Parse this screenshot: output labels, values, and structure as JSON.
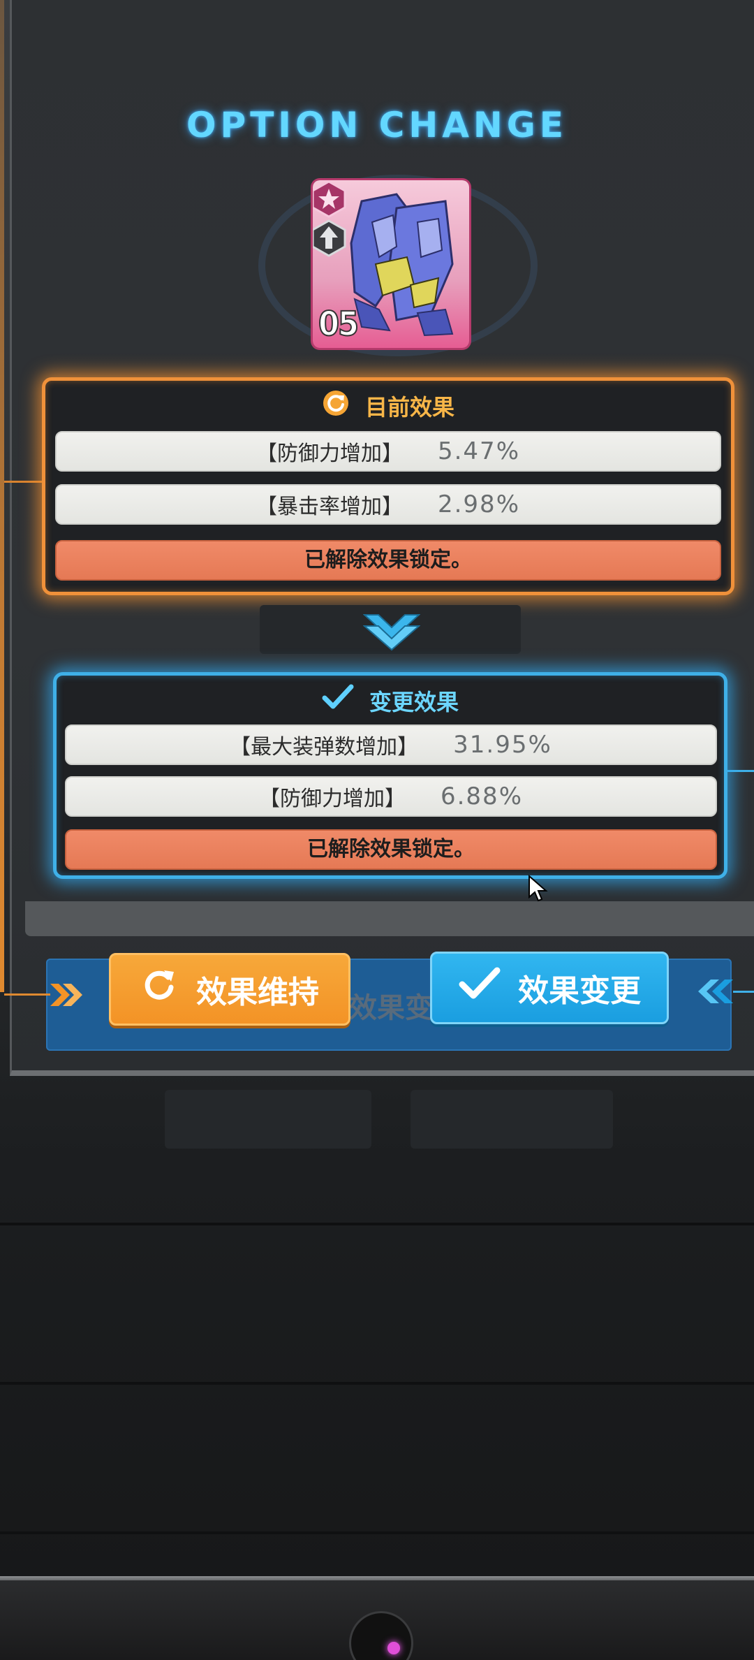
{
  "title": "OPTION CHANGE",
  "item_card": {
    "level": "05",
    "badge_top_icon": "star-emblem-icon",
    "badge_mid_icon": "arrow-emblem-icon",
    "art_icon": "mech-part-icon"
  },
  "current_effect": {
    "header": "目前效果",
    "header_icon": "refresh-icon",
    "rows": [
      {
        "name": "【防御力增加】",
        "value": "5.47%"
      },
      {
        "name": "【暴击率增加】",
        "value": "2.98%"
      }
    ],
    "lock_status": "已解除效果锁定。"
  },
  "changed_effect": {
    "header": "变更效果",
    "header_icon": "check-icon",
    "rows": [
      {
        "name": "【最大装弹数增加】",
        "value": "31.95%"
      },
      {
        "name": "【防御力增加】",
        "value": "6.88%"
      }
    ],
    "lock_status": "已解除效果锁定。"
  },
  "buttons": {
    "keep_label": "效果维持",
    "change_label": "效果变更",
    "background_text": "效果变更"
  },
  "colors": {
    "accent_orange": "#f0913a",
    "accent_blue": "#3fb0e8",
    "title_blue": "#63d7ff",
    "lock_red": "#e57955"
  }
}
